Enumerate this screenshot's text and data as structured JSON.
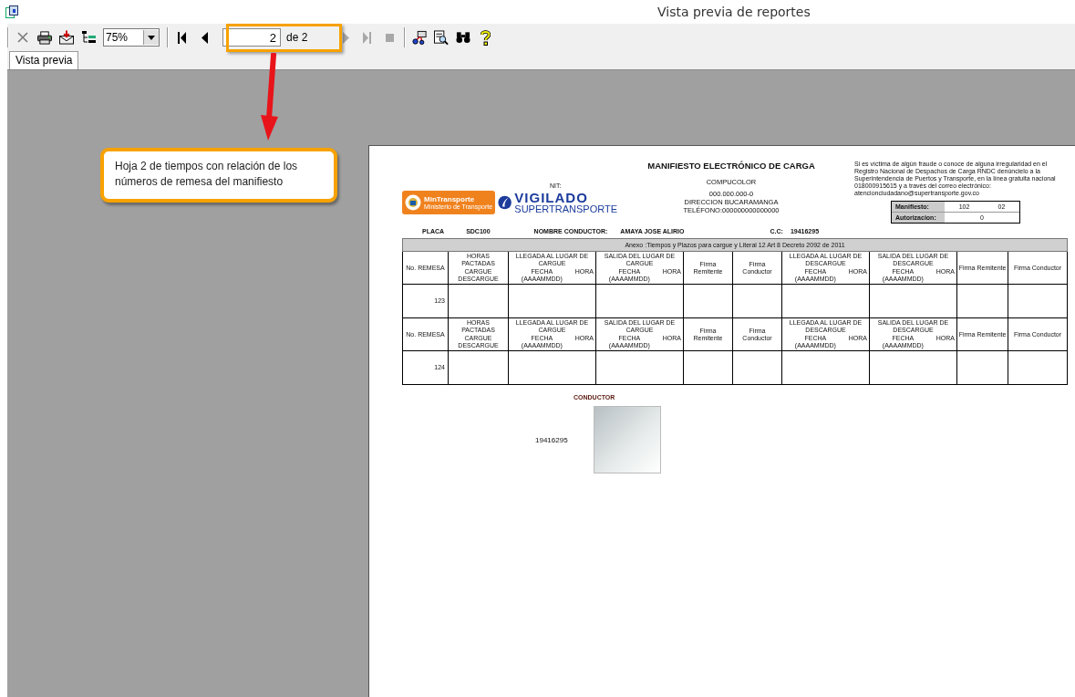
{
  "window": {
    "title": "Vista previa de reportes"
  },
  "toolbar": {
    "groups": [
      {
        "items": [
          {
            "kind": "close",
            "disabled": true
          },
          {
            "kind": "print",
            "disabled": false
          },
          {
            "kind": "export",
            "disabled": false
          },
          {
            "kind": "tree",
            "disabled": false
          },
          {
            "kind": "zoom",
            "value": "75%"
          }
        ]
      },
      {
        "items": [
          {
            "kind": "first",
            "disabled": false
          },
          {
            "kind": "prev",
            "disabled": false
          },
          {
            "kind": "page",
            "value": "2",
            "total": "de 2"
          },
          {
            "kind": "next",
            "disabled": true
          },
          {
            "kind": "last",
            "disabled": true
          },
          {
            "kind": "stop",
            "disabled": true
          }
        ]
      },
      {
        "items": [
          {
            "kind": "connect",
            "disabled": false
          },
          {
            "kind": "inspect",
            "disabled": false
          },
          {
            "kind": "find",
            "disabled": false
          },
          {
            "kind": "help",
            "disabled": false
          }
        ]
      }
    ]
  },
  "tabs": [
    {
      "label": "Vista previa",
      "selected": true
    }
  ],
  "callout": {
    "text": "Hoja 2 de tiempos con relación de los números de remesa del manifiesto"
  },
  "report": {
    "title": "MANIFIESTO ELECTRÓNICO DE CARGA",
    "nit_label": "NIT:",
    "logo_ministry": {
      "name": "MinTransporte",
      "subtitle": "Ministerio de Transporte"
    },
    "logo_watch": {
      "line1": "VIGILADO",
      "line2": "SUPERTRANSPORTE"
    },
    "company": [
      "COMPUCOLOR",
      "000.000.000-0",
      "DIRECCION  BUCARAMANGA",
      "TELÉFONO:000000000000000"
    ],
    "notice": "Si es víctima de algún fraude o conoce de alguna irregularidad en el Registro Nacional de Despachos de Carga RNDC denúncielo a la Superintendencia de Puertos y Transporte, en la línea gratuita nacional 018000915615 y a través del correo electrónico: atencionciudadano@supertransporte.gov.co",
    "manifest_box": [
      {
        "label": "Manifiesto:",
        "values": [
          "102",
          "02"
        ]
      },
      {
        "label": "Autorizacion:",
        "values": [
          "0"
        ]
      }
    ],
    "info": [
      {
        "label": "PLACA",
        "value": "SDC100"
      },
      {
        "label": "NOMBRE CONDUCTOR:",
        "value": "AMAYA JOSE ALIRIO"
      },
      {
        "label": "C.C:",
        "value": "19416295"
      }
    ],
    "annex_title": "Anexo :Tiempos y Plazos para cargue y  Literal 12 Art 8 Decreto 2092 de 2011",
    "sections": [
      {
        "remesa_label": "No. REMESA",
        "remesa": "123",
        "columns": [
          {
            "kind": "pair",
            "top": "HORAS PACTADAS",
            "bottom": [
              "CARGUE DESCARGUE"
            ]
          },
          {
            "kind": "pair",
            "top": "LLEGADA AL LUGAR DE CARGUE",
            "bottom": [
              "FECHA (AAAAMMDD)",
              "HORA"
            ]
          },
          {
            "kind": "pair",
            "top": "SALIDA DEL LUGAR DE CARGUE",
            "bottom": [
              "FECHA (AAAAMMDD)",
              "HORA"
            ]
          },
          {
            "kind": "single",
            "top": "Firma Remitente"
          },
          {
            "kind": "single",
            "top": "Firma Conductor"
          },
          {
            "kind": "pair",
            "top": "LLEGADA AL LUGAR DE DESCARGUE",
            "bottom": [
              "FECHA (AAAAMMDD)",
              "HORA"
            ]
          },
          {
            "kind": "pair",
            "top": "SALIDA DEL LUGAR DE DESCARGUE",
            "bottom": [
              "FECHA (AAAAMMDD)",
              "HORA"
            ]
          },
          {
            "kind": "single",
            "top": "Firma Remitente"
          },
          {
            "kind": "single",
            "top": "Firma Conductor"
          }
        ]
      },
      {
        "remesa_label": "No. REMESA",
        "remesa": "124",
        "columns": [
          {
            "kind": "pair",
            "top": "HORAS PACTADAS",
            "bottom": [
              "CARGUE DESCARGUE"
            ]
          },
          {
            "kind": "pair",
            "top": "LLEGADA AL LUGAR DE CARGUE",
            "bottom": [
              "FECHA (AAAAMMDD)",
              "HORA"
            ]
          },
          {
            "kind": "pair",
            "top": "SALIDA DEL LUGAR DE CARGUE",
            "bottom": [
              "FECHA (AAAAMMDD)",
              "HORA"
            ]
          },
          {
            "kind": "single",
            "top": "Firma Remitente"
          },
          {
            "kind": "single",
            "top": "Firma Conductor"
          },
          {
            "kind": "pair",
            "top": "LLEGADA AL LUGAR DE DESCARGUE",
            "bottom": [
              "FECHA (AAAAMMDD)",
              "HORA"
            ]
          },
          {
            "kind": "pair",
            "top": "SALIDA DEL LUGAR DE DESCARGUE",
            "bottom": [
              "FECHA (AAAAMMDD)",
              "HORA"
            ]
          },
          {
            "kind": "single",
            "top": "Firma Remitente"
          },
          {
            "kind": "single",
            "top": "Firma Conductor"
          }
        ]
      }
    ],
    "conductor_label": "CONDUCTOR",
    "conductor_id": "19416295"
  }
}
